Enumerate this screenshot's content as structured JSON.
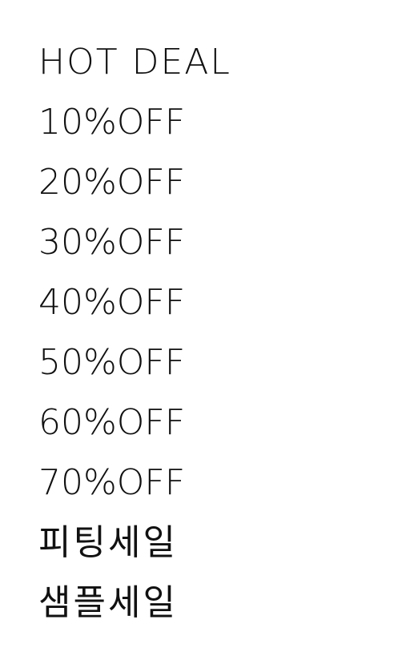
{
  "menu": {
    "title": "HOT DEAL",
    "items": [
      {
        "label": "10%OFF"
      },
      {
        "label": "20%OFF"
      },
      {
        "label": "30%OFF"
      },
      {
        "label": "40%OFF"
      },
      {
        "label": "50%OFF"
      },
      {
        "label": "60%OFF"
      },
      {
        "label": "70%OFF"
      },
      {
        "label": "피팅세일"
      },
      {
        "label": "샘플세일"
      }
    ]
  }
}
